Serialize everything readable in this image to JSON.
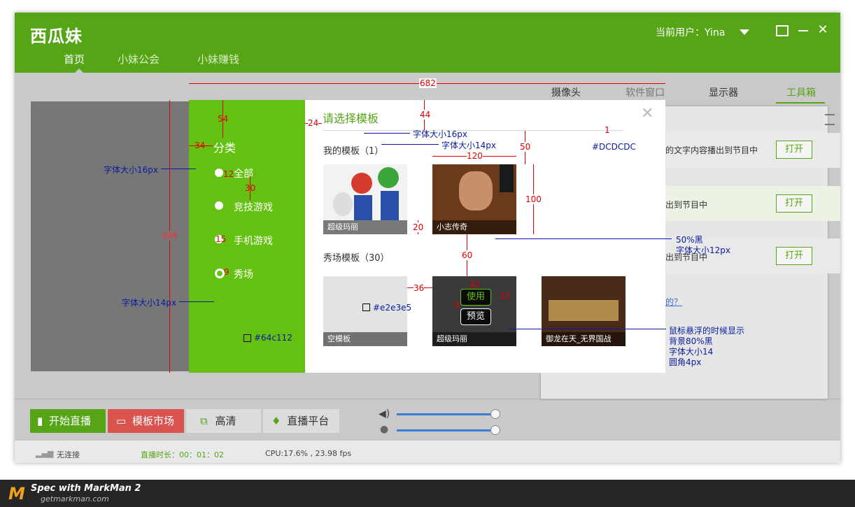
{
  "app": {
    "logo": "西瓜妹",
    "nav": [
      "首页",
      "小妹公会",
      "小妹赚钱"
    ],
    "user_label": "当前用户：Yina"
  },
  "right_panel": {
    "tabs": [
      "摄像头",
      "软件窗口",
      "显示器",
      "工具箱"
    ],
    "rows": [
      {
        "text": "的文字内容播出到节目中",
        "button": "打开"
      },
      {
        "text": "出到节目中",
        "button": "打开"
      },
      {
        "text": "出到节目中",
        "button": "打开"
      }
    ],
    "link": "的？"
  },
  "bottom_bar": {
    "start_live": "开始直播",
    "template_market": "模板市场",
    "hd": "高清",
    "platform": "直播平台"
  },
  "status": {
    "connection": "无连接",
    "duration": "直播时长：00：01：02",
    "perf": "CPU:17.6% , 23.98 fps"
  },
  "dialog": {
    "title": "请选择模板",
    "category_heading": "分类",
    "categories": [
      "全部",
      "竞技游戏",
      "手机游戏",
      "秀场"
    ],
    "my_templates": "我的模板（1）",
    "show_templates": "秀场模板（30）",
    "templates_mine": [
      {
        "caption": "超级玛丽"
      },
      {
        "caption": "小志传奇"
      }
    ],
    "templates_show": [
      {
        "caption": "空模板"
      },
      {
        "caption": "超级玛丽"
      },
      {
        "caption": "御龙在天_无界国战"
      }
    ],
    "hover_use": "使用",
    "hover_preview": "预览"
  },
  "annotations": {
    "w682": "682",
    "h44": "44",
    "h54": "54",
    "w24": "24",
    "w34": "34",
    "h394": "394",
    "w12": "12",
    "h30": "30",
    "h15": "15",
    "h9": "9",
    "w120": "120",
    "h50": "50",
    "h1": "1",
    "h100": "100",
    "h20": "20",
    "h60": "60",
    "w36": "36",
    "w42": "42",
    "h9b": "9",
    "h22": "22",
    "font16_title": "字体大小16px",
    "font14_mine": "字体大小14px",
    "color_dcdcdc": "#DCDCDC",
    "font16_left": "字体大小16px",
    "font14_left": "字体大小14px",
    "color_64c112": "#64c112",
    "color_e2e3e5": "#e2e3e5",
    "caption_note_1": "50%黑",
    "caption_note_2": "字体大小12px",
    "hover_note_1": "鼠标悬浮的时候显示",
    "hover_note_2": "背景80%黑",
    "hover_note_3": "字体大小14",
    "hover_note_4": "圆角4px"
  },
  "footer": {
    "title": "Spec with MarkMan 2",
    "sub": "getmarkman.com"
  },
  "colors": {
    "brand_green": "#55a517",
    "dialog_green": "#64c112",
    "separator": "#DCDCDC",
    "empty_tpl": "#e2e3e5",
    "annotation_red": "#e00000",
    "annotation_blue": "#0a1aa0"
  }
}
